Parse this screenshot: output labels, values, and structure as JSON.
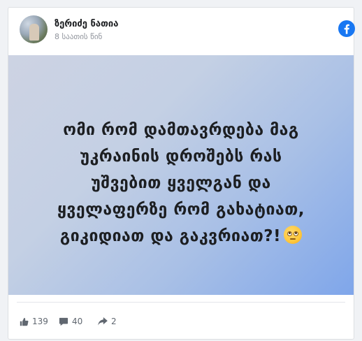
{
  "author": {
    "name": "ზერიძე ნათია",
    "time": "8 საათის წინ"
  },
  "post": {
    "lines": [
      "ომი რომ დამთავრდება მაგ",
      "უკრაინის დროშებს რას",
      "უშვებით ყველგან და",
      "ყველაფერზე რომ გახატიათ,",
      "გიკიდიათ და გაკვრიათ?!"
    ]
  },
  "stats": {
    "likes": "139",
    "comments": "40",
    "shares": "2"
  },
  "colors": {
    "facebook_blue": "#1877f2",
    "text": "#1c1e21",
    "muted": "#606770"
  },
  "icons": {
    "platform": "facebook-logo-icon",
    "like": "thumbs-up-icon",
    "comment": "speech-bubble-icon",
    "share": "share-arrow-icon",
    "emoji": "eye-roll-emoji"
  }
}
